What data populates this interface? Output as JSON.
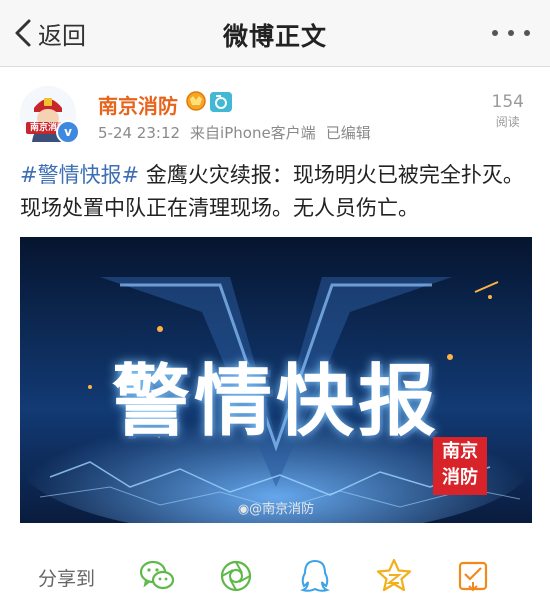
{
  "nav": {
    "back_label": "返回",
    "title": "微博正文"
  },
  "post": {
    "author": "南京消防",
    "avatar_text": "南京消防",
    "date": "5-24 23:12",
    "source": "来自iPhone客户端",
    "edited": "已编辑",
    "read_count": "154",
    "read_label": "阅读",
    "hashtag": "#警情快报#",
    "text": " 金鹰火灾续报：现场明火已被完全扑灭。现场处置中队正在清理现场。无人员伤亡。"
  },
  "image": {
    "title": "警情快报",
    "stamp_line1": "南京",
    "stamp_line2": "消防",
    "watermark": "@南京消防"
  },
  "share": {
    "label": "分享到",
    "icons": [
      "wechat-icon",
      "moments-icon",
      "qq-icon",
      "qzone-icon",
      "favorite-icon"
    ]
  },
  "colors": {
    "author": "#e8641c",
    "hashtag": "#3e6fb5",
    "share_green": "#5fb84a",
    "share_blue": "#3ea2e6",
    "share_yellow": "#f2b01e",
    "share_orange": "#f08a1c"
  }
}
